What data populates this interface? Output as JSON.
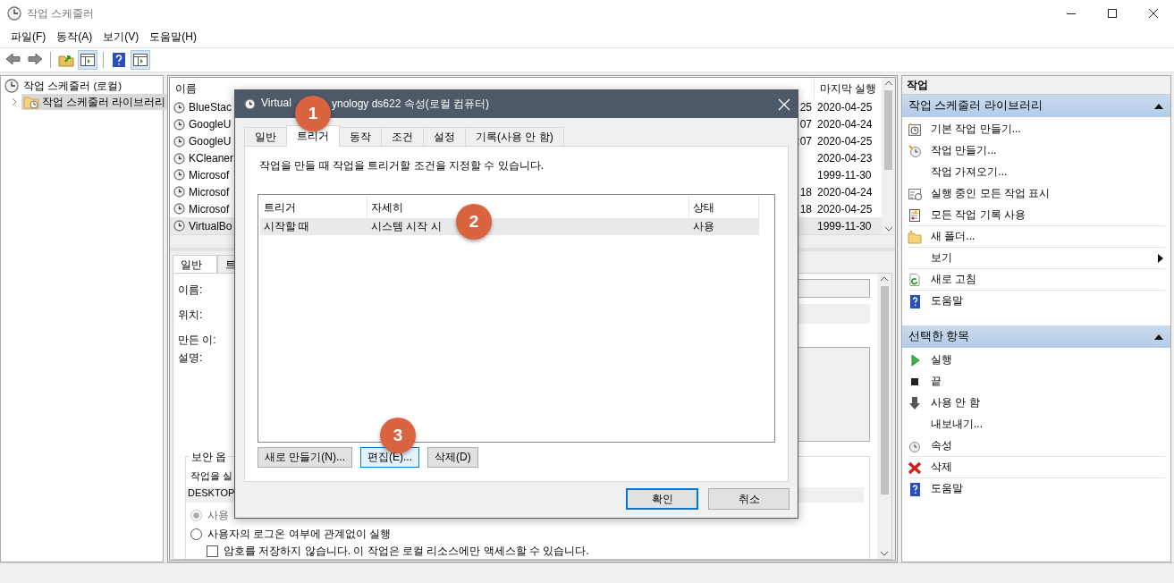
{
  "window": {
    "title": "작업 스케줄러"
  },
  "menu": [
    {
      "label": "파일(F)"
    },
    {
      "label": "동작(A)"
    },
    {
      "label": "보기(V)"
    },
    {
      "label": "도움말(H)"
    }
  ],
  "toolbar": [
    {
      "kind": "back",
      "active": false
    },
    {
      "kind": "forward",
      "active": false
    },
    {
      "kind": "folder",
      "active": false
    },
    {
      "kind": "panel",
      "active": true
    },
    {
      "kind": "help",
      "active": false
    },
    {
      "kind": "panel",
      "active": true
    }
  ],
  "tree": [
    {
      "label": "작업 스케줄러 (로컬)",
      "selected": false,
      "children": [
        {
          "label": "작업 스케줄러 라이브러리",
          "selected": true,
          "expanded": false
        }
      ]
    }
  ],
  "task_list": {
    "columns": [
      {
        "label": "이름"
      },
      {
        "label": "마지막 실행"
      }
    ],
    "rows": [
      {
        "name": "BlueStac",
        "column_4": "25",
        "last_run": "2020-04-25",
        "selected": false
      },
      {
        "name": "GoogleU",
        "column_4": "07",
        "last_run": "2020-04-24",
        "selected": false
      },
      {
        "name": "GoogleU",
        "column_4": ":07",
        "last_run": "2020-04-25",
        "selected": false
      },
      {
        "name": "KCleaner",
        "column_4": "",
        "last_run": "2020-04-23",
        "selected": false
      },
      {
        "name": "Microsof",
        "column_4": "",
        "last_run": "1999-11-30",
        "selected": false
      },
      {
        "name": "Microsof",
        "column_4": "18",
        "last_run": "2020-04-24",
        "selected": false
      },
      {
        "name": "Microsof",
        "column_4": "18",
        "last_run": "2020-04-25",
        "selected": false
      },
      {
        "name": "VirtualBo",
        "column_4": "",
        "last_run": "1999-11-30",
        "selected": true
      }
    ]
  },
  "details": {
    "tabs": [
      {
        "label": "일반",
        "selected": true
      },
      {
        "label": "트",
        "selected": false
      }
    ],
    "fields": [
      {
        "label": "이름:",
        "kind": "input"
      },
      {
        "label": "위치:",
        "kind": "readonly"
      },
      {
        "label": "만든 이:",
        "kind": "blank"
      },
      {
        "label": "설명:",
        "kind": "textarea"
      }
    ],
    "security": {
      "title": "보안 옵",
      "prompt": "작업을 실",
      "account": "DESKTOP",
      "options": [
        {
          "label": "사용",
          "kind": "radio",
          "checked": true,
          "disabled": true
        },
        {
          "label": "사용자의 로그온 여부에 관계없이 실행",
          "kind": "radio",
          "checked": false,
          "disabled": false
        },
        {
          "label": "암호를 저장하지 않습니다. 이 작업은 로컬 리소스에만 액세스할 수 있습니다.",
          "kind": "checkbox",
          "checked": false,
          "disabled": false
        }
      ]
    }
  },
  "actions": {
    "title": "작업",
    "sections": [
      {
        "title": "작업 스케줄러 라이브러리",
        "expanded": true,
        "items": [
          {
            "label": "기본 작업 만들기...",
            "separator_before": false,
            "submenu": false
          },
          {
            "label": "작업 만들기...",
            "separator_before": false,
            "submenu": false
          },
          {
            "label": "작업 가져오기...",
            "separator_before": false,
            "submenu": false
          },
          {
            "label": "실행 중인 모든 작업 표시",
            "separator_before": false,
            "submenu": false
          },
          {
            "label": "모든 작업 기록 사용",
            "separator_before": false,
            "submenu": false
          },
          {
            "label": "새 폴더...",
            "separator_before": true,
            "submenu": false
          },
          {
            "label": "보기",
            "separator_before": true,
            "submenu": true
          },
          {
            "label": "새로 고침",
            "separator_before": true,
            "submenu": false
          },
          {
            "label": "도움말",
            "separator_before": true,
            "submenu": false
          }
        ]
      },
      {
        "title": "선택한 항목",
        "expanded": true,
        "items": [
          {
            "label": "실행",
            "separator_before": false,
            "submenu": false
          },
          {
            "label": "끝",
            "separator_before": false,
            "submenu": false
          },
          {
            "label": "사용 안 함",
            "separator_before": false,
            "submenu": false
          },
          {
            "label": "내보내기...",
            "separator_before": false,
            "submenu": false
          },
          {
            "label": "속성",
            "separator_before": false,
            "submenu": false
          },
          {
            "label": "삭제",
            "separator_before": true,
            "submenu": false
          },
          {
            "label": "도움말",
            "separator_before": true,
            "submenu": false
          }
        ]
      }
    ]
  },
  "dialog": {
    "title": "Virtual",
    "title_rest": "ynology ds622 속성(로컬 컴퓨터)",
    "tabs": [
      {
        "label": "일반",
        "selected": false
      },
      {
        "label": "트리거",
        "selected": true
      },
      {
        "label": "동작",
        "selected": false
      },
      {
        "label": "조건",
        "selected": false
      },
      {
        "label": "설정",
        "selected": false
      },
      {
        "label": "기록(사용 안 함)",
        "selected": false
      }
    ],
    "description": "작업을 만들 때 작업을 트리거할 조건을 지정할 수 있습니다.",
    "trigger_table": {
      "columns": [
        {
          "label": "트리거"
        },
        {
          "label": "자세히"
        },
        {
          "label": "상태"
        }
      ],
      "rows": [
        {
          "cells": [
            "시작할 때",
            "시스템 시작 시",
            "사용"
          ],
          "selected": true
        }
      ]
    },
    "buttons": [
      {
        "label": "새로 만들기(N)...",
        "focused": false
      },
      {
        "label": "편집(E)...",
        "focused": true
      },
      {
        "label": "삭제(D)",
        "focused": false
      }
    ],
    "footer_buttons": [
      {
        "label": "확인",
        "default": true
      },
      {
        "label": "취소",
        "default": false
      }
    ]
  },
  "annotations": [
    {
      "label": "1"
    },
    {
      "label": "2"
    },
    {
      "label": "3"
    }
  ]
}
